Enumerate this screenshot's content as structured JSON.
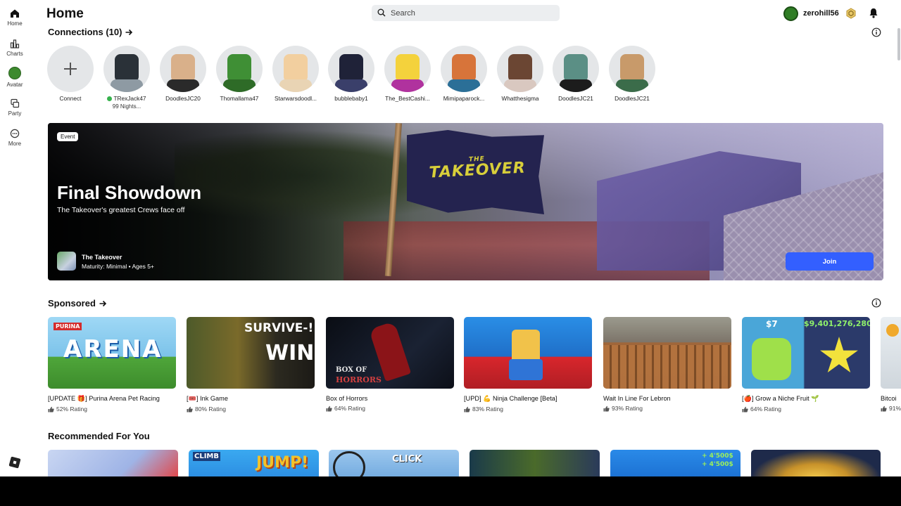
{
  "sidebar": {
    "items": [
      {
        "label": "Home",
        "icon": "home-icon"
      },
      {
        "label": "Charts",
        "icon": "charts-icon"
      },
      {
        "label": "Avatar",
        "icon": "avatar-icon"
      },
      {
        "label": "Party",
        "icon": "party-icon"
      },
      {
        "label": "More",
        "icon": "more-icon"
      }
    ]
  },
  "header": {
    "title": "Home",
    "search_placeholder": "Search",
    "username": "zerohill56"
  },
  "connections": {
    "title": "Connections (10)",
    "connect_label": "Connect",
    "friends": [
      {
        "name": "TRexJack47",
        "status": "99 Nights...",
        "online": true
      },
      {
        "name": "DoodlesJC20"
      },
      {
        "name": "Thomallama47"
      },
      {
        "name": "Starwarsdoodl..."
      },
      {
        "name": "bubblebaby1"
      },
      {
        "name": "The_BestCashi..."
      },
      {
        "name": "Mimipaparock..."
      },
      {
        "name": "Whatthesigma"
      },
      {
        "name": "DoodlesJC21"
      },
      {
        "name": "DoodlesJC21"
      }
    ]
  },
  "banner": {
    "badge": "Event",
    "title": "Final Showdown",
    "subtitle": "The Takeover's greatest Crews face off",
    "game_name": "The Takeover",
    "maturity": "Maturity: Minimal • Ages 5+",
    "join_label": "Join",
    "flag_small": "THE",
    "flag_big": "TAKEOVER"
  },
  "sponsored": {
    "title": "Sponsored",
    "games": [
      {
        "title": "[UPDATE 🎁] Purina Arena Pet Racing",
        "rating": "52% Rating"
      },
      {
        "title": "[🎟️] Ink Game",
        "rating": "80% Rating"
      },
      {
        "title": "Box of Horrors",
        "rating": "64% Rating"
      },
      {
        "title": "[UPD] 💪 Ninja Challenge [Beta]",
        "rating": "83% Rating"
      },
      {
        "title": "Wait In Line For Lebron",
        "rating": "93% Rating"
      },
      {
        "title": "[🍎] Grow a Niche Fruit 🌱",
        "rating": "64% Rating"
      },
      {
        "title": "Bitcoi",
        "rating": "91%"
      }
    ],
    "thumb_text": {
      "purina": "PURINA",
      "arena": "ARENA",
      "survive": "SURVIVE-!",
      "win": "WIN",
      "box_of": "BOX OF",
      "horrors": "HORRORS",
      "price_small": "$7",
      "price_big": "$9,401,276,280"
    }
  },
  "recommended": {
    "title": "Recommended For You",
    "thumb_text": {
      "climb": "CLIMB",
      "jump": "JUMP!",
      "click": "CLICK",
      "money1": "+ 4'500$",
      "money2": "+ 4'500$"
    }
  },
  "colors": {
    "accent": "#335fff",
    "online": "#37b24d",
    "page_bg": "#ffffff"
  }
}
